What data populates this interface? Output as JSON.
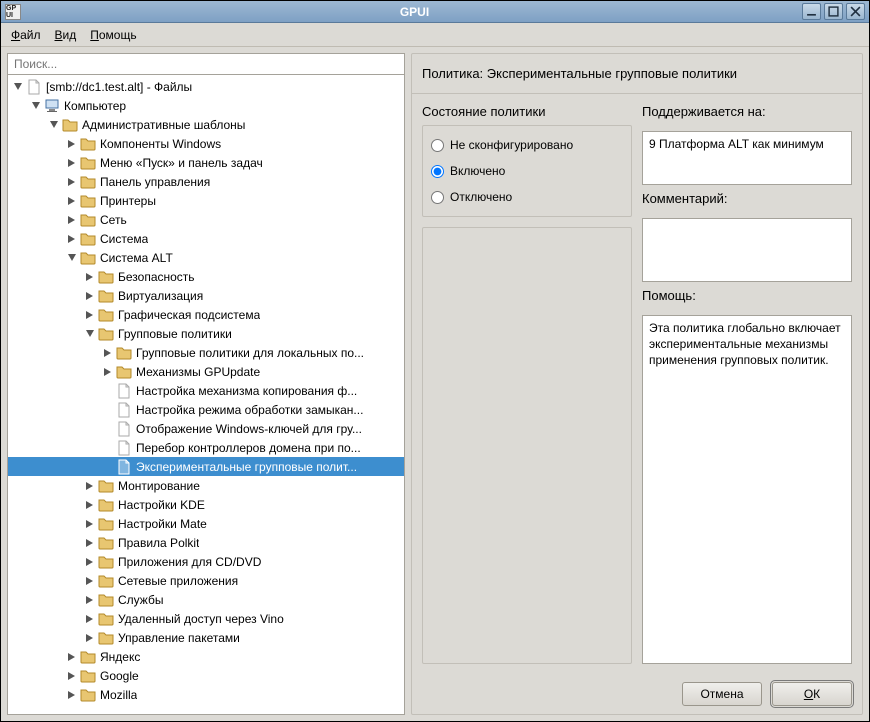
{
  "window": {
    "app_icon_text": "GP UI",
    "title": "GPUI"
  },
  "menu": {
    "file": "Файл",
    "view": "Вид",
    "help": "Помощь"
  },
  "search": {
    "placeholder": "Поиск..."
  },
  "tree": [
    {
      "indent": 0,
      "exp": "open",
      "icon": "file",
      "label": "[smb://dc1.test.alt] - Файлы"
    },
    {
      "indent": 1,
      "exp": "open",
      "icon": "computer",
      "label": "Компьютер"
    },
    {
      "indent": 2,
      "exp": "open",
      "icon": "folder",
      "label": "Административные шаблоны"
    },
    {
      "indent": 3,
      "exp": "closed",
      "icon": "folder",
      "label": "Компоненты Windows"
    },
    {
      "indent": 3,
      "exp": "closed",
      "icon": "folder",
      "label": "Меню «Пуск» и панель задач"
    },
    {
      "indent": 3,
      "exp": "closed",
      "icon": "folder",
      "label": "Панель управления"
    },
    {
      "indent": 3,
      "exp": "closed",
      "icon": "folder",
      "label": "Принтеры"
    },
    {
      "indent": 3,
      "exp": "closed",
      "icon": "folder",
      "label": "Сеть"
    },
    {
      "indent": 3,
      "exp": "closed",
      "icon": "folder",
      "label": "Система"
    },
    {
      "indent": 3,
      "exp": "open",
      "icon": "folder",
      "label": "Система ALT"
    },
    {
      "indent": 4,
      "exp": "closed",
      "icon": "folder",
      "label": "Безопасность"
    },
    {
      "indent": 4,
      "exp": "closed",
      "icon": "folder",
      "label": "Виртуализация"
    },
    {
      "indent": 4,
      "exp": "closed",
      "icon": "folder",
      "label": "Графическая подсистема"
    },
    {
      "indent": 4,
      "exp": "open",
      "icon": "folder",
      "label": "Групповые политики"
    },
    {
      "indent": 5,
      "exp": "closed",
      "icon": "folder",
      "label": "Групповые политики для локальных по..."
    },
    {
      "indent": 5,
      "exp": "closed",
      "icon": "folder",
      "label": "Механизмы GPUpdate"
    },
    {
      "indent": 5,
      "exp": "none",
      "icon": "file",
      "label": "Настройка механизма копирования ф..."
    },
    {
      "indent": 5,
      "exp": "none",
      "icon": "file",
      "label": "Настройка режима обработки замыкан..."
    },
    {
      "indent": 5,
      "exp": "none",
      "icon": "file",
      "label": "Отображение Windows-ключей для гру..."
    },
    {
      "indent": 5,
      "exp": "none",
      "icon": "file",
      "label": "Перебор контроллеров домена при по..."
    },
    {
      "indent": 5,
      "exp": "none",
      "icon": "file",
      "label": "Экспериментальные групповые полит...",
      "selected": true
    },
    {
      "indent": 4,
      "exp": "closed",
      "icon": "folder",
      "label": "Монтирование"
    },
    {
      "indent": 4,
      "exp": "closed",
      "icon": "folder",
      "label": "Настройки KDE"
    },
    {
      "indent": 4,
      "exp": "closed",
      "icon": "folder",
      "label": "Настройки Mate"
    },
    {
      "indent": 4,
      "exp": "closed",
      "icon": "folder",
      "label": "Правила Polkit"
    },
    {
      "indent": 4,
      "exp": "closed",
      "icon": "folder",
      "label": "Приложения для CD/DVD"
    },
    {
      "indent": 4,
      "exp": "closed",
      "icon": "folder",
      "label": "Сетевые приложения"
    },
    {
      "indent": 4,
      "exp": "closed",
      "icon": "folder",
      "label": "Службы"
    },
    {
      "indent": 4,
      "exp": "closed",
      "icon": "folder",
      "label": "Удаленный доступ через Vino"
    },
    {
      "indent": 4,
      "exp": "closed",
      "icon": "folder",
      "label": "Управление пакетами"
    },
    {
      "indent": 3,
      "exp": "closed",
      "icon": "folder",
      "label": "Яндекс"
    },
    {
      "indent": 3,
      "exp": "closed",
      "icon": "folder",
      "label": "Google"
    },
    {
      "indent": 3,
      "exp": "closed",
      "icon": "folder",
      "label": "Mozilla"
    }
  ],
  "policy": {
    "header_prefix": "Политика: ",
    "header_name": "Экспериментальные групповые политики",
    "state_title": "Состояние политики",
    "states": {
      "not_configured": "Не сконфигурировано",
      "enabled": "Включено",
      "disabled": "Отключено",
      "selected": "enabled"
    },
    "supported_title": "Поддерживается на:",
    "supported_text": "9 Платформа ALT как минимум",
    "comment_title": "Комментарий:",
    "comment_text": "",
    "help_title": "Помощь:",
    "help_text": "Эта политика глобально включает экспериментальные механизмы применения групповых политик."
  },
  "buttons": {
    "cancel": "Отмена",
    "ok": "ОК"
  }
}
